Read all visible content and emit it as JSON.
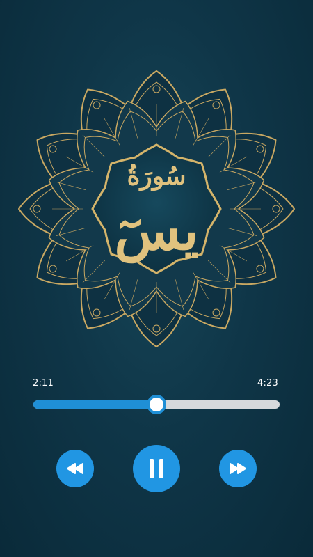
{
  "artwork": {
    "title_line1": "سُورَةُ",
    "title_line2": "يسٓ"
  },
  "player": {
    "elapsed": "2:11",
    "total": "4:23",
    "progress": 0.5
  },
  "colors": {
    "background": "#0f3648",
    "accent": "#2196e3",
    "gold": "#d4b46a"
  },
  "icons": {
    "rewind": "rewind-icon",
    "play_pause": "pause-icon",
    "forward": "fast-forward-icon"
  }
}
